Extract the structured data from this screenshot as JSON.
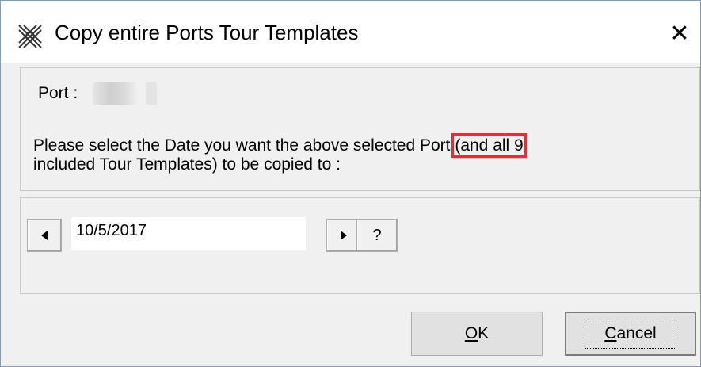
{
  "window": {
    "title": "Copy entire Ports Tour Templates",
    "close_glyph": "✕"
  },
  "port": {
    "label": "Port :",
    "value_redacted": true
  },
  "message": {
    "before_highlight": "Please select the Date you want the above selected Port ",
    "highlight": "(and all 9",
    "line2": "included Tour Templates) to be copied to :"
  },
  "date_picker": {
    "value": "10/5/2017",
    "prev_icon": "triangle-left-icon",
    "next_icon": "triangle-right-icon",
    "help_label": "?"
  },
  "buttons": {
    "ok_mnemonic": "O",
    "ok_rest": "K",
    "cancel_mnemonic": "C",
    "cancel_rest": "ancel"
  },
  "colors": {
    "highlight_border": "#e0302f",
    "window_border": "#7f9db9",
    "dialog_bg": "#f0f0f0"
  }
}
